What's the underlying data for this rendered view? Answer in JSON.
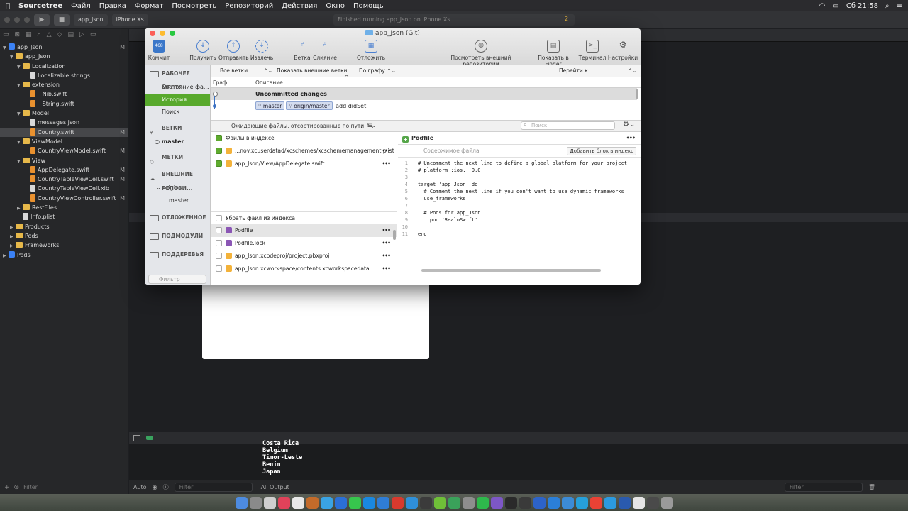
{
  "menubar": {
    "app": "Sourcetree",
    "items": [
      "Файл",
      "Правка",
      "Формат",
      "Посмотреть",
      "Репозиторий",
      "Действия",
      "Окно",
      "Помощь"
    ],
    "clock": "Сб 21:58"
  },
  "xcode": {
    "scheme": "app_Json",
    "device": "iPhone Xs",
    "status": "Finished running app_Json on iPhone Xs",
    "warnings": "2",
    "nav_filter": "Filter",
    "bottom_filter": "Filter",
    "output_filter": "Filter",
    "auto": "Auto",
    "all_output": "All Output",
    "tree": [
      {
        "label": "app_Json",
        "depth": 0,
        "type": "proj",
        "marker": "M",
        "open": true
      },
      {
        "label": "app_Json",
        "depth": 1,
        "type": "folder",
        "open": true
      },
      {
        "label": "Localization",
        "depth": 2,
        "type": "folder",
        "open": true
      },
      {
        "label": "Localizable.strings",
        "depth": 3,
        "type": "filew"
      },
      {
        "label": "extension",
        "depth": 2,
        "type": "folder",
        "open": true
      },
      {
        "label": "+Nib.swift",
        "depth": 3,
        "type": "file"
      },
      {
        "label": "+String.swift",
        "depth": 3,
        "type": "file"
      },
      {
        "label": "Model",
        "depth": 2,
        "type": "folder",
        "open": true
      },
      {
        "label": "messages.json",
        "depth": 3,
        "type": "filew"
      },
      {
        "label": "Country.swift",
        "depth": 3,
        "type": "file",
        "marker": "M",
        "selected": true
      },
      {
        "label": "ViewModel",
        "depth": 2,
        "type": "folder",
        "open": true
      },
      {
        "label": "CountryViewModel.swift",
        "depth": 3,
        "type": "file",
        "marker": "M"
      },
      {
        "label": "View",
        "depth": 2,
        "type": "folder",
        "open": true
      },
      {
        "label": "AppDelegate.swift",
        "depth": 3,
        "type": "file",
        "marker": "M"
      },
      {
        "label": "CountryTableViewCell.swift",
        "depth": 3,
        "type": "file",
        "marker": "M"
      },
      {
        "label": "CountryTableViewCell.xib",
        "depth": 3,
        "type": "filew"
      },
      {
        "label": "CountryViewController.swift",
        "depth": 3,
        "type": "file",
        "marker": "M"
      },
      {
        "label": "RestFiles",
        "depth": 2,
        "type": "folder"
      },
      {
        "label": "Info.plist",
        "depth": 2,
        "type": "filew"
      },
      {
        "label": "Products",
        "depth": 1,
        "type": "folder"
      },
      {
        "label": "Pods",
        "depth": 1,
        "type": "folder"
      },
      {
        "label": "Frameworks",
        "depth": 1,
        "type": "folder"
      },
      {
        "label": "Pods",
        "depth": 0,
        "type": "proj"
      }
    ],
    "output": [
      "Costa Rica",
      "Belgium",
      "Timor-Leste",
      "Benin",
      "Japan"
    ]
  },
  "sourcetree": {
    "title": "app_Json (Git)",
    "commit_badge": "468",
    "toolbar": [
      "Коммит",
      "Получить",
      "Отправить",
      "Извлечь",
      "Ветка",
      "Слияние",
      "Отложить",
      "Посмотреть внешний репозиторий",
      "Показать в Finder",
      "Терминал",
      "Настройки"
    ],
    "sidebar": {
      "workspace": "РАБОЧЕЕ МЕСТО",
      "ws_items": [
        "Состояние фа...",
        "История",
        "Поиск"
      ],
      "branches": "ВЕТКИ",
      "branch": "master",
      "tags": "МЕТКИ",
      "remotes": "ВНЕШНИЕ РЕПОЗИ...",
      "remote": "origin",
      "remote_branch": "master",
      "stashes": "ОТЛОЖЕННОЕ",
      "submodules": "ПОДМОДУЛИ",
      "subtrees": "ПОДДЕРЕВЬЯ",
      "filter": "Фильтр"
    },
    "filters": {
      "branches": "Все ветки",
      "remote": "Показать внешние ветки",
      "order": "По графу",
      "goto": "Перейти к:"
    },
    "columns": {
      "graph": "Граф",
      "description": "Описание"
    },
    "commits": {
      "uncommitted": "Uncommitted changes",
      "branch_tag": "master",
      "remote_tag": "origin/master",
      "message": "add didSet"
    },
    "pending": "Ожидающие файлы, отсортированные по пути",
    "search": "Поиск",
    "staged_title": "Файлы в индексе",
    "staged": [
      {
        "name": "...nov.xcuserdatad/xcschemes/xcschememanagement.plist",
        "kind": "mod"
      },
      {
        "name": "app_Json/View/AppDelegate.swift",
        "kind": "mod"
      }
    ],
    "unstaged_title": "Убрать файл из индекса",
    "unstaged": [
      {
        "name": "Podfile",
        "kind": "unk"
      },
      {
        "name": "Podfile.lock",
        "kind": "unk"
      },
      {
        "name": "app_Json.xcodeproj/project.pbxproj",
        "kind": "mod"
      },
      {
        "name": "app_Json.xcworkspace/contents.xcworkspacedata",
        "kind": "mod"
      }
    ],
    "diff": {
      "file": "Podfile",
      "section": "Содержимое файла",
      "add_button": "Добавить блок в индекс",
      "lines": [
        "# Uncomment the next line to define a global platform for your project",
        "# platform :ios, '9.0'",
        "",
        "target 'app_Json' do",
        "  # Comment the next line if you don't want to use dynamic frameworks",
        "  use_frameworks!",
        "",
        "  # Pods for app_Json",
        "    pod 'RealmSwift'",
        "",
        "end"
      ]
    }
  }
}
